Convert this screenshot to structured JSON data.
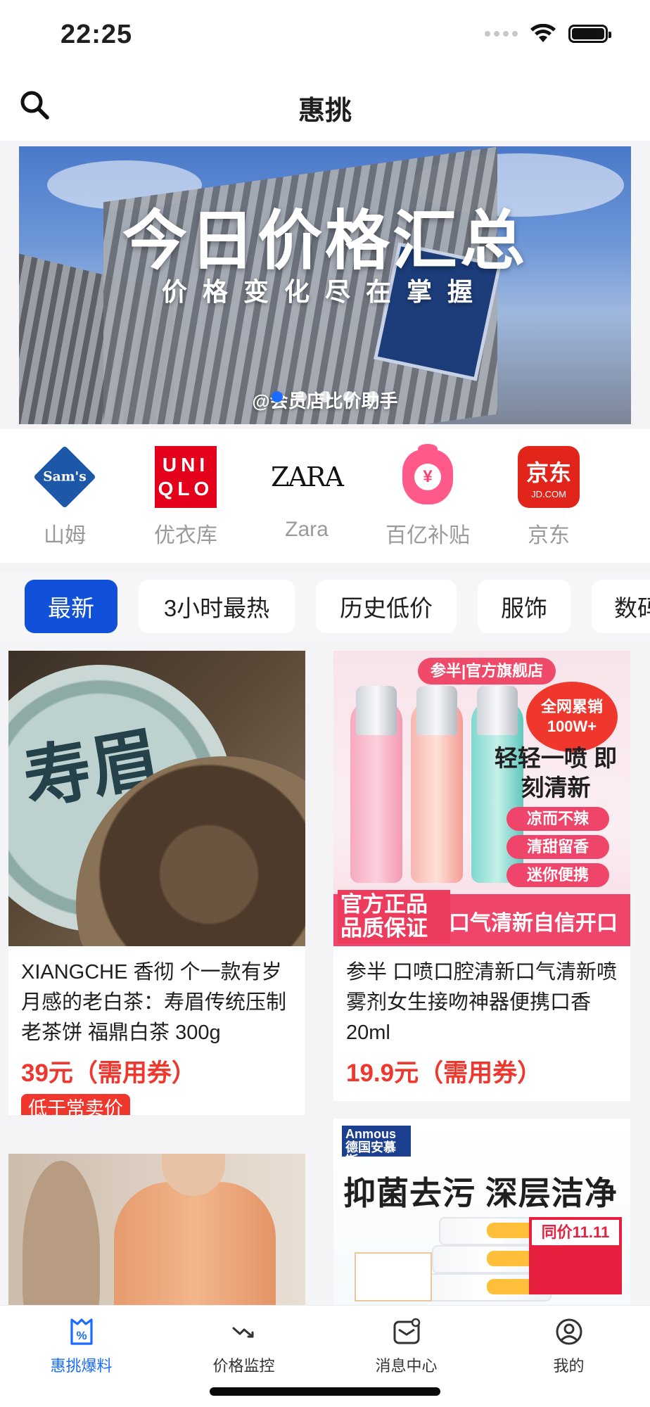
{
  "status_bar": {
    "time": "22:25"
  },
  "nav": {
    "title": "惠挑",
    "search_icon": "search-icon"
  },
  "banner": {
    "title": "今日价格汇总",
    "subtitle": "价格变化尽在掌握",
    "credit": "@会员店比价助手",
    "dot_count": 5,
    "active_dot": 0
  },
  "stores": [
    {
      "name": "山姆",
      "logo": "sams-club-logo",
      "logo_text": "Sam's"
    },
    {
      "name": "优衣库",
      "logo": "uniqlo-logo",
      "logo_text": "UNIQLO"
    },
    {
      "name": "Zara",
      "logo": "zara-logo",
      "logo_text": "ZARA"
    },
    {
      "name": "百亿补贴",
      "logo": "money-bag-logo",
      "logo_text": "¥"
    },
    {
      "name": "京东",
      "logo": "jd-logo",
      "logo_text": "京东",
      "logo_subtext": "JD.COM"
    }
  ],
  "filter_tabs": [
    {
      "label": "最新",
      "active": true
    },
    {
      "label": "3小时最热",
      "active": false
    },
    {
      "label": "历史低价",
      "active": false
    },
    {
      "label": "服饰",
      "active": false
    },
    {
      "label": "数码",
      "active": false
    }
  ],
  "products": [
    {
      "title": "XIANGCHE 香彻 个一款有岁月感的老白茶：寿眉传统压制老茶饼 福鼎白茶 300g",
      "price": "39元（需用券）",
      "badge": "低于常卖价",
      "image_text": "寿眉"
    },
    {
      "title": "参半 口喷口腔清新口气清新喷雾剂女生接吻神器便携口香20ml",
      "price": "19.9元（需用券）",
      "image_top": "参半|官方旗舰店",
      "image_star": "全网累销 100W+",
      "image_slogan": "轻轻一喷 即刻清新",
      "image_pills": [
        "凉而不辣",
        "清甜留香",
        "迷你便携"
      ],
      "image_foot_left": "官方正品 品质保证",
      "image_foot_right": "口气清新自信开口"
    },
    {
      "title": "",
      "price": ""
    },
    {
      "title": "",
      "price": "",
      "image_brand": "Anmous 德国安慕斯",
      "image_title": "抑菌去污 深层洁净",
      "image_tag": "同价11.11"
    }
  ],
  "tabbar": [
    {
      "label": "惠挑爆料",
      "icon": "discount-tag-icon",
      "active": true
    },
    {
      "label": "价格监控",
      "icon": "trend-down-icon",
      "active": false
    },
    {
      "label": "消息中心",
      "icon": "message-icon",
      "active": false
    },
    {
      "label": "我的",
      "icon": "profile-icon",
      "active": false
    }
  ],
  "colors": {
    "accent": "#1150d8",
    "price": "#f0372e",
    "tab_active": "#1a6bff"
  }
}
